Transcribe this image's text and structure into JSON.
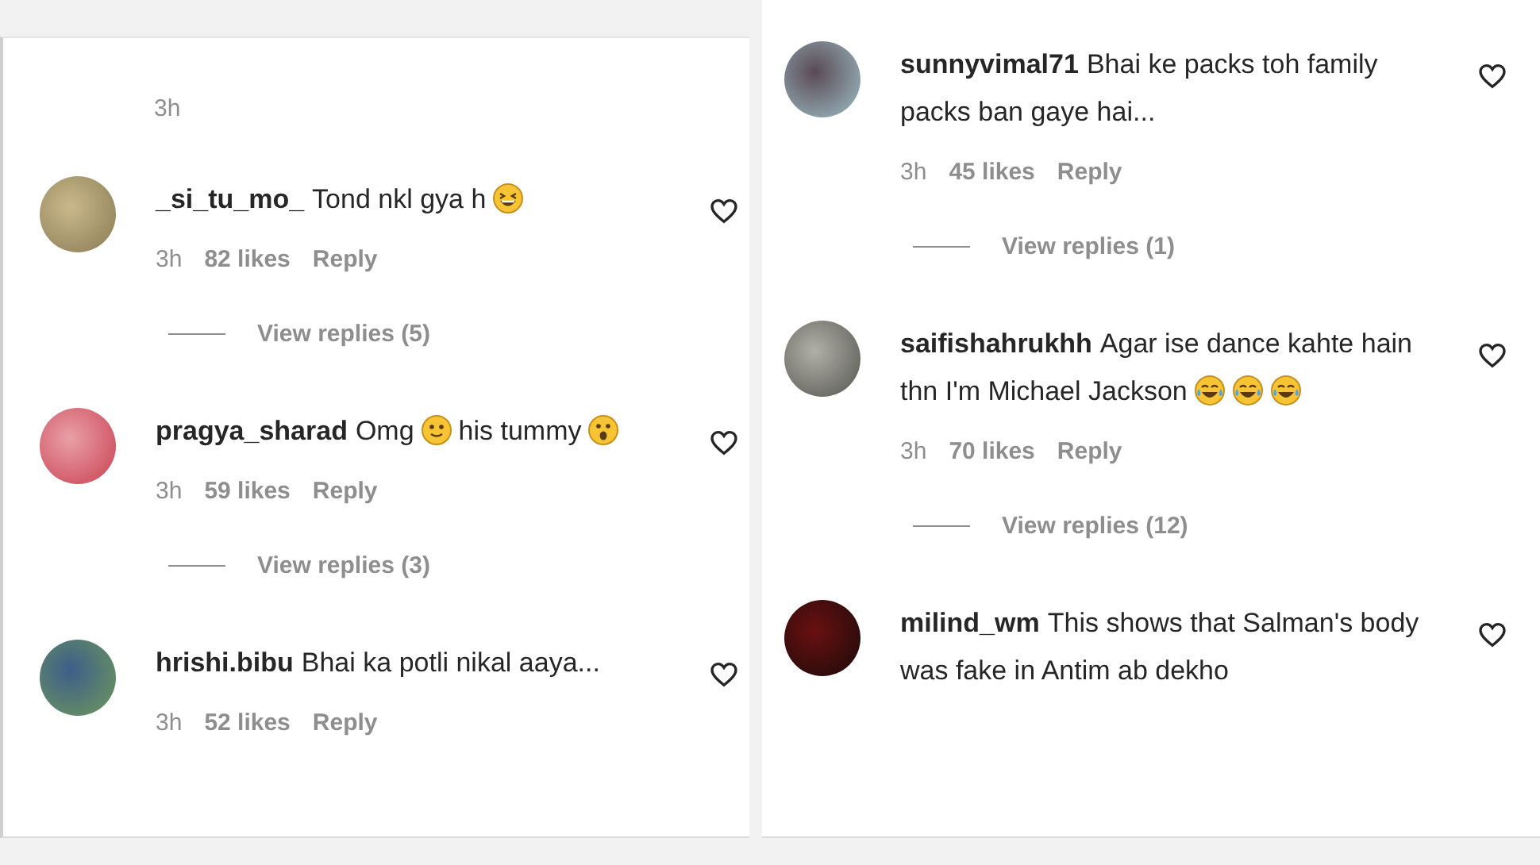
{
  "panels": [
    {
      "caption_time": "3h",
      "comments": [
        {
          "username": "_si_tu_mo_",
          "body": [
            {
              "kind": "text",
              "text": "Tond nkl gya h"
            },
            {
              "kind": "grin"
            }
          ],
          "time": "3h",
          "likes": "82 likes",
          "reply": "Reply",
          "view_replies": "View replies (5)"
        },
        {
          "username": "pragya_sharad",
          "body": [
            {
              "kind": "text",
              "text": "Omg"
            },
            {
              "kind": "smile"
            },
            {
              "kind": "text",
              "text": "his tummy"
            },
            {
              "kind": "surprised"
            }
          ],
          "time": "3h",
          "likes": "59 likes",
          "reply": "Reply",
          "view_replies": "View replies (3)"
        },
        {
          "username": "hrishi.bibu",
          "body": [
            {
              "kind": "text",
              "text": "Bhai ka potli nikal aaya..."
            }
          ],
          "time": "3h",
          "likes": "52 likes",
          "reply": "Reply"
        }
      ]
    },
    {
      "comments": [
        {
          "username": "sunnyvimal71",
          "body": [
            {
              "kind": "text",
              "text": "Bhai ke packs toh family packs ban gaye hai..."
            }
          ],
          "time": "3h",
          "likes": "45 likes",
          "reply": "Reply",
          "view_replies": "View replies (1)"
        },
        {
          "username": "saifishahrukhh",
          "body": [
            {
              "kind": "text",
              "text": "Agar ise dance kahte hain thn I'm Michael Jackson"
            },
            {
              "kind": "tears"
            },
            {
              "kind": "tears"
            },
            {
              "kind": "tears"
            }
          ],
          "time": "3h",
          "likes": "70 likes",
          "reply": "Reply",
          "view_replies": "View replies (12)"
        },
        {
          "username": "milind_wm",
          "body": [
            {
              "kind": "text",
              "text": "This shows that Salman's body was fake in Antim ab dekho"
            }
          ]
        }
      ]
    }
  ]
}
